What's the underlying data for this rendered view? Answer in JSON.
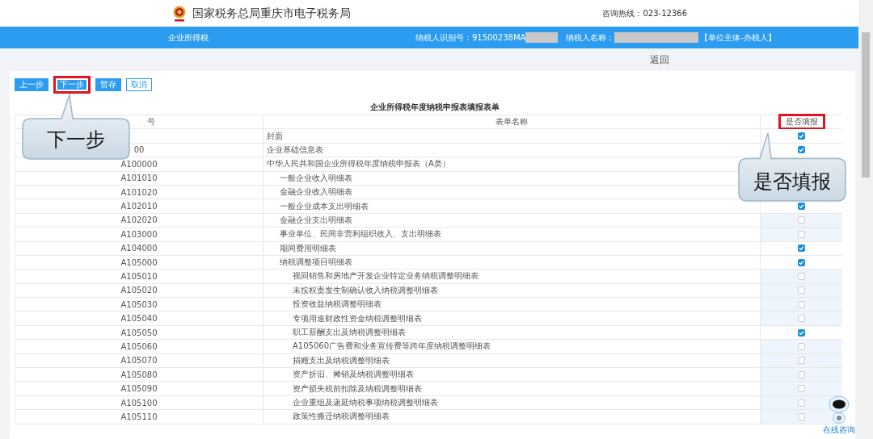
{
  "header": {
    "title": "国家税务总局重庆市电子税务局",
    "hotline": "咨询热线：023-12366"
  },
  "info_bar": {
    "tax_type": "企业所得税",
    "taxpayer_id_label": "纳税人识别号：91500238MA",
    "taxpayer_name_label": "纳税人名称：",
    "role": "【单位主体-办税人】"
  },
  "back_link": "返回",
  "toolbar": [
    {
      "label": "上一步",
      "kind": "primary",
      "highlighted": false
    },
    {
      "label": "下一步",
      "kind": "primary",
      "highlighted": true
    },
    {
      "label": "暂存",
      "kind": "primary",
      "highlighted": false
    },
    {
      "label": "取消",
      "kind": "plain",
      "highlighted": false
    }
  ],
  "table": {
    "title": "企业所得税年度纳税申报表填报表单",
    "columns": [
      {
        "label": "号",
        "highlighted": false
      },
      {
        "label": "表单名称",
        "highlighted": false
      },
      {
        "label": "是否填报",
        "highlighted": true
      }
    ],
    "rows": [
      {
        "name": "封面",
        "checked": true
      },
      {
        "code": "00",
        "name": "企业基础信息表",
        "checked": true
      },
      {
        "code": "A100000",
        "name": "中华人民共和国企业所得税年度纳税申报表（A类）",
        "children": [
          {
            "code": "A101010",
            "name": "一般企业收入明细表"
          },
          {
            "code": "A101020",
            "name": "金融企业收入明细表"
          },
          {
            "code": "A102010",
            "name": "一般企业成本支出明细表",
            "checked": true
          },
          {
            "code": "A102020",
            "name": "金融企业支出明细表",
            "checked": false
          },
          {
            "code": "A103000",
            "name": "事业单位、民间非营利组织收入、支出明细表",
            "checked": false
          },
          {
            "code": "A104000",
            "name": "期间费用明细表",
            "checked": true
          },
          {
            "code": "A105000",
            "name": "纳税调整项目明细表",
            "checked": true,
            "children": [
              {
                "code": "A105010",
                "name": "视同销售和房地产开发企业特定业务纳税调整明细表",
                "checked": false
              },
              {
                "code": "A105020",
                "name": "未按权责发生制确认收入纳税调整明细表",
                "checked": false
              },
              {
                "code": "A105030",
                "name": "投资收益纳税调整明细表",
                "checked": false
              },
              {
                "code": "A105040",
                "name": "专项用途财政性资金纳税调整明细表",
                "checked": false
              },
              {
                "code": "A105050",
                "name": "职工薪酬支出及纳税调整明细表",
                "checked": true
              },
              {
                "code": "A105060",
                "name": "A105060广告费和业务宣传费等跨年度纳税调整明细表",
                "checked": false
              },
              {
                "code": "A105070",
                "name": "捐赠支出及纳税调整明细表",
                "checked": false
              },
              {
                "code": "A105080",
                "name": "资产折旧、摊销及纳税调整明细表",
                "checked": false
              },
              {
                "code": "A105090",
                "name": "资产损失税前扣除及纳税调整明细表",
                "checked": false
              },
              {
                "code": "A105100",
                "name": "企业重组及递延纳税事项纳税调整明细表",
                "checked": false
              },
              {
                "code": "A105110",
                "name": "政策性搬迁纳税调整明细表",
                "checked": false
              }
            ]
          }
        ]
      }
    ]
  },
  "callouts": [
    {
      "text": "下一步"
    },
    {
      "text": "是否填报"
    }
  ],
  "chat_widget": {
    "label": "在线咨询"
  }
}
